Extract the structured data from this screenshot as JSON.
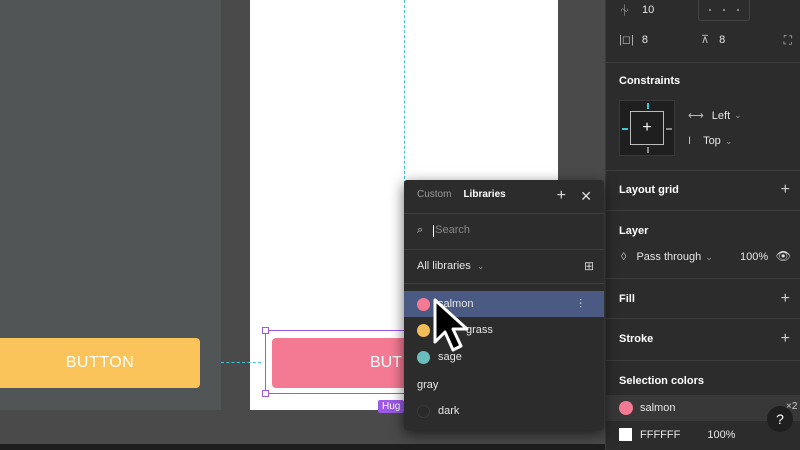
{
  "canvas": {
    "button_left_label": "BUTTON",
    "button_right_label": "BUT",
    "hug_tag": "Hug"
  },
  "right_panel": {
    "spacing_value": "10",
    "padding_h_value": "8",
    "padding_v_value": "8",
    "constraints": {
      "title": "Constraints",
      "horizontal": "Left",
      "vertical": "Top"
    },
    "layout_grid_title": "Layout grid",
    "layer": {
      "title": "Layer",
      "blend_mode": "Pass through",
      "opacity": "100%"
    },
    "fill_title": "Fill",
    "stroke_title": "Stroke",
    "selection_colors": {
      "title": "Selection colors",
      "items": [
        {
          "name": "salmon",
          "color": "#f47a94",
          "count": "×2"
        },
        {
          "name": "FFFFFF",
          "color": "#ffffff",
          "opacity": "100%"
        }
      ]
    },
    "help_label": "?"
  },
  "popover": {
    "tabs": [
      {
        "label": "Custom",
        "active": false
      },
      {
        "label": "Libraries",
        "active": true
      }
    ],
    "search_placeholder": "Search",
    "library_filter": "All libraries",
    "styles": [
      {
        "name": "salmon",
        "color": "#f47a94",
        "selected": true
      },
      {
        "name": "grass",
        "color": "#f2bd57",
        "selected": false
      },
      {
        "name": "sage",
        "color": "#6bbdbd",
        "selected": false
      },
      {
        "name": "gray",
        "color": "",
        "selected": false
      },
      {
        "name": "dark",
        "color": "#2a2a2a",
        "selected": false
      }
    ]
  }
}
